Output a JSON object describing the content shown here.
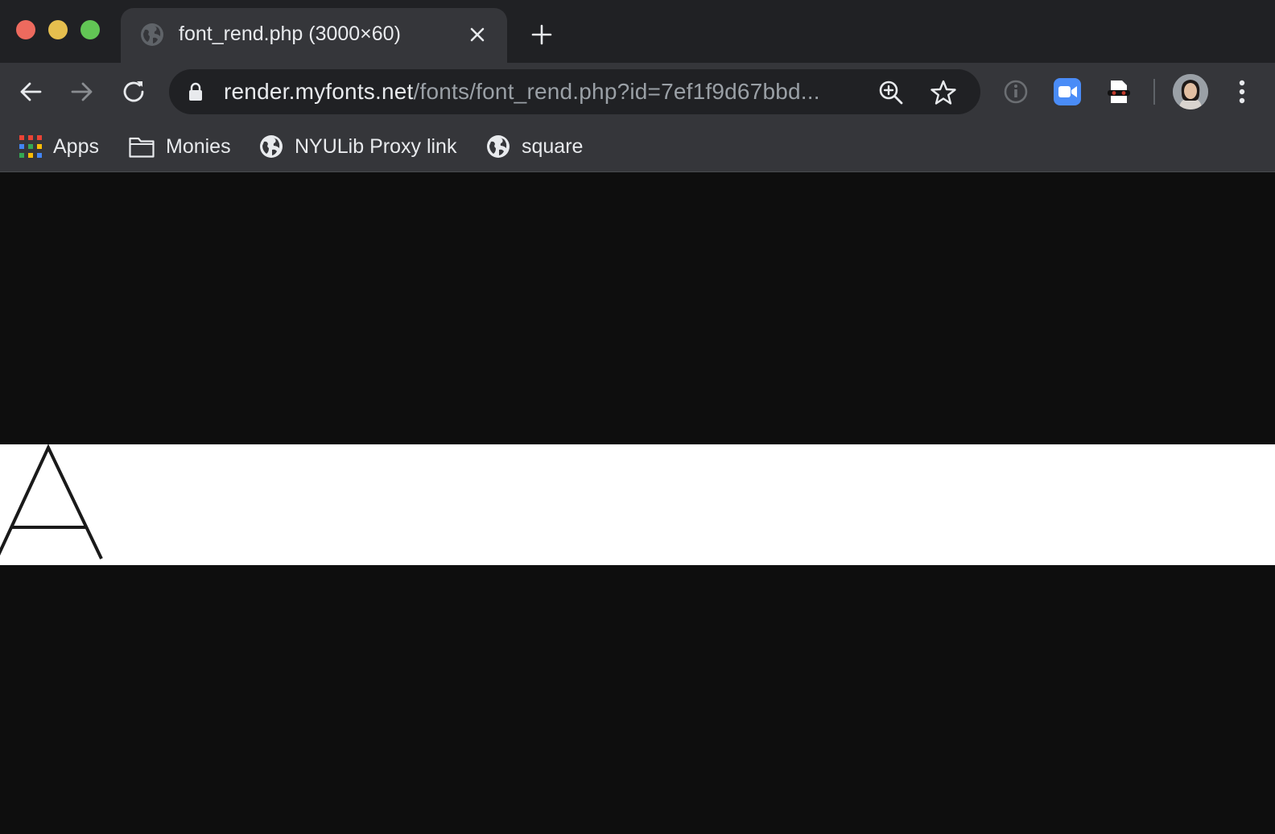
{
  "tab": {
    "title": "font_rend.php (3000×60)",
    "favicon": "globe-icon"
  },
  "omnibox": {
    "host": "render.myfonts.net",
    "path": "/fonts/font_rend.php?id=7ef1f9d67bbd..."
  },
  "bookmarks": [
    {
      "label": "Apps",
      "icon": "apps-grid-icon"
    },
    {
      "label": "Monies",
      "icon": "folder-icon"
    },
    {
      "label": "NYULib Proxy link",
      "icon": "globe-icon"
    },
    {
      "label": "square",
      "icon": "globe-icon"
    }
  ],
  "page": {
    "rendered_glyph": "A",
    "background": "#0e0e0e",
    "image_background": "#ffffff"
  },
  "colors": {
    "tabstrip": "#202124",
    "toolbar": "#35363a",
    "close": "#ed6a5e",
    "minimize": "#e6bf4e",
    "maximize": "#62c655",
    "zoom_ext": "#4a8cf7"
  }
}
